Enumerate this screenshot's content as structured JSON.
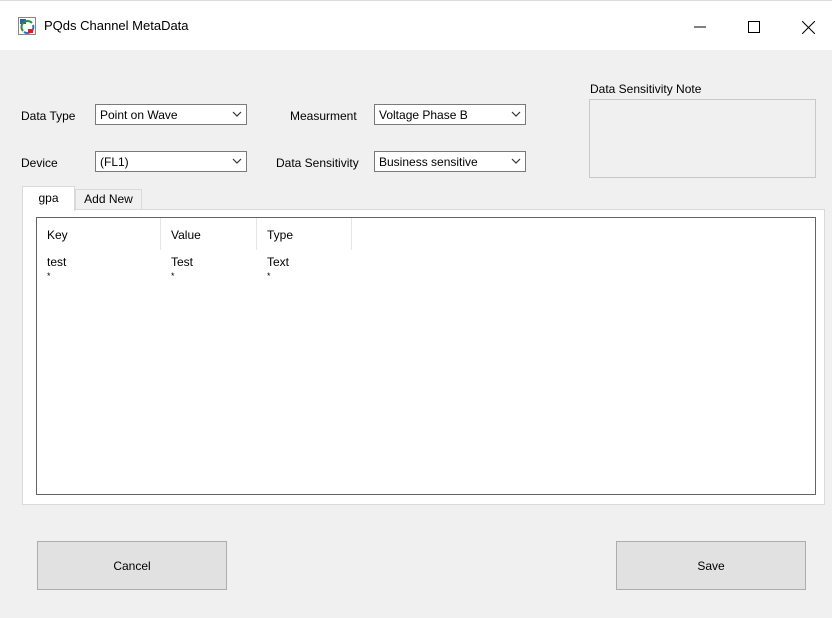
{
  "window": {
    "title": "PQds Channel MetaData",
    "controls": {
      "minimize": "—",
      "maximize": "☐",
      "close": "✕"
    }
  },
  "form": {
    "data_type": {
      "label": "Data Type",
      "value": "Point on Wave"
    },
    "measurement": {
      "label": "Measurment",
      "value": "Voltage Phase B"
    },
    "device": {
      "label": "Device",
      "value": "(FL1)"
    },
    "data_sensitivity": {
      "label": "Data Sensitivity",
      "value": "Business sensitive"
    },
    "sensitivity_note": {
      "label": "Data Sensitivity Note",
      "value": ""
    }
  },
  "tabs": [
    {
      "label": "gpa",
      "active": true
    },
    {
      "label": "Add New",
      "active": false
    }
  ],
  "grid": {
    "columns": [
      "Key",
      "Value",
      "Type"
    ],
    "rows": [
      {
        "key": "test",
        "value": "Test",
        "type": "Text"
      },
      {
        "key": "*",
        "value": "*",
        "type": "*"
      }
    ]
  },
  "buttons": {
    "cancel": "Cancel",
    "save": "Save"
  },
  "colors": {
    "background": "#f0f0f0",
    "button_face": "#e1e1e1",
    "border": "#7a7a7a"
  }
}
